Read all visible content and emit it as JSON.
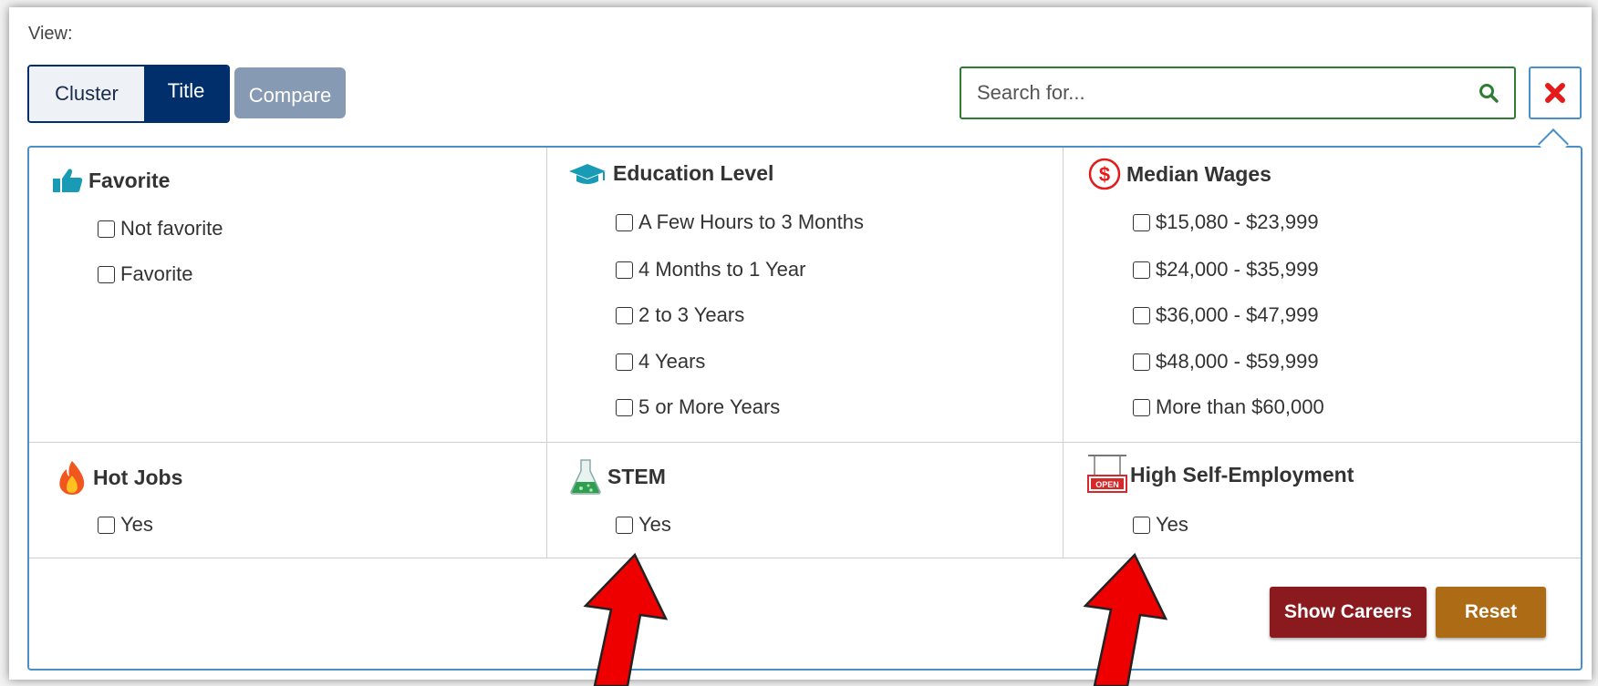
{
  "view": {
    "label": "View:",
    "toggle": {
      "cluster_label": "Cluster",
      "title_label": "Title",
      "active": "Title"
    },
    "compare_label": "Compare"
  },
  "search": {
    "placeholder": "Search for...",
    "value": ""
  },
  "filters": {
    "favorite": {
      "title": "Favorite",
      "icon": "thumbs-up-icon",
      "options": [
        "Not favorite",
        "Favorite"
      ]
    },
    "education": {
      "title": "Education Level",
      "icon": "graduation-cap-icon",
      "options": [
        "A Few Hours to 3 Months",
        "4 Months to 1 Year",
        "2 to 3 Years",
        "4 Years",
        "5 or More Years"
      ]
    },
    "wages": {
      "title": "Median Wages",
      "icon": "dollar-circle-icon",
      "options": [
        "$15,080 - $23,999",
        "$24,000 - $35,999",
        "$36,000 - $47,999",
        "$48,000 - $59,999",
        "More than $60,000"
      ]
    },
    "hot_jobs": {
      "title": "Hot Jobs",
      "icon": "flame-icon",
      "options": [
        "Yes"
      ]
    },
    "stem": {
      "title": "STEM",
      "icon": "flask-icon",
      "options": [
        "Yes"
      ]
    },
    "self_employment": {
      "title": "High Self-Employment",
      "icon": "open-sign-icon",
      "sign_text": "OPEN",
      "options": [
        "Yes"
      ]
    }
  },
  "actions": {
    "show_careers_label": "Show Careers",
    "reset_label": "Reset"
  },
  "colors": {
    "primary_navy": "#002f6c",
    "compare_gray_blue": "#879ab3",
    "search_border_green": "#2e7d32",
    "panel_border_blue": "#4a90c8",
    "close_red": "#e31b1b",
    "show_careers_maroon": "#8b1a1f",
    "reset_orange": "#ad6b16",
    "icon_teal": "#1a9bb5",
    "annotation_arrow_red": "#ee0000"
  }
}
